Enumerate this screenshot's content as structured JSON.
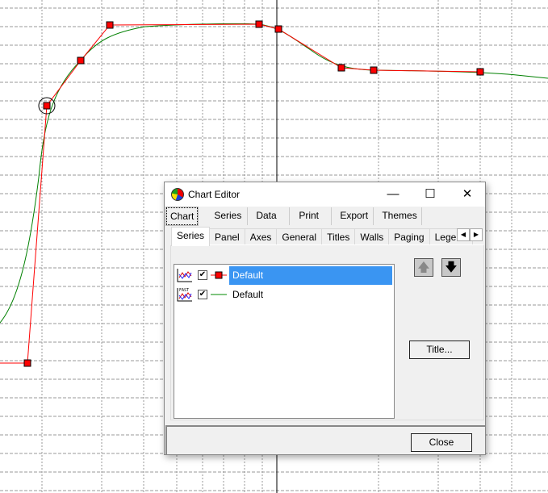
{
  "chart_data": {
    "type": "line",
    "series": [
      {
        "name": "Default",
        "color": "#ff0000",
        "style": "line-with-square-points",
        "points": [
          [
            34,
            450
          ],
          [
            58,
            131
          ],
          [
            100,
            75
          ],
          [
            136,
            31
          ],
          [
            321,
            30
          ],
          [
            345,
            36
          ],
          [
            423,
            84
          ],
          [
            463,
            87
          ],
          [
            595,
            89
          ]
        ]
      },
      {
        "name": "Default",
        "color": "#008000",
        "style": "fast-line-smooth"
      }
    ],
    "grid": true,
    "x_axis": "logarithmic-grid",
    "note": "no axis labels visible"
  },
  "dialog": {
    "title": "Chart Editor",
    "window_buttons": {
      "minimize": "—",
      "maximize": "☐",
      "close": "✕"
    },
    "main_tabs": [
      "Chart",
      "Series",
      "Data",
      "Print",
      "Export",
      "Themes"
    ],
    "sub_tabs": [
      "Series",
      "Panel",
      "Axes",
      "General",
      "Titles",
      "Walls",
      "Paging",
      "Legend"
    ],
    "series_list": [
      {
        "label": "Default",
        "checked": true,
        "selected": true,
        "type": "line",
        "color": "#ff0000"
      },
      {
        "label": "Default",
        "checked": true,
        "selected": false,
        "type": "fast-line",
        "color": "#008000"
      }
    ],
    "move_up": "🡅",
    "move_down": "🡇",
    "title_button": "Title...",
    "close_button": "Close",
    "scroll_left": "◀",
    "scroll_right": "▶",
    "check": "✔"
  }
}
